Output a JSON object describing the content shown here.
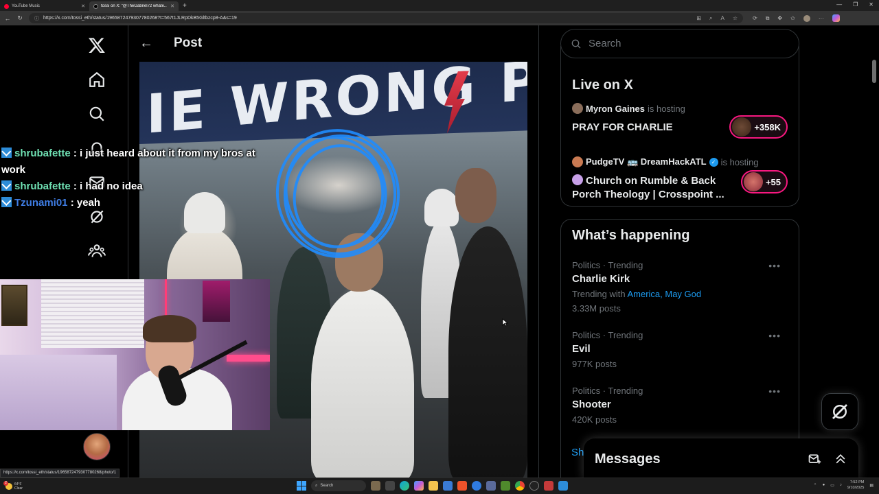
{
  "browser": {
    "tabs": [
      {
        "title": "YouTube Music",
        "active": false
      },
      {
        "title": "tossi on X: \"@TheGabriel72 whate...\"",
        "active": true
      }
    ],
    "url": "https://x.com/tossi_eth/status/1965872479307780268?t=567t1JLRpDkB5Gltbzcp8-A&s=19",
    "status_url": "https://x.com/tossi_eth/status/1965872479307780268/photo/1"
  },
  "post": {
    "title": "Post",
    "video_banner_text": "IE WRONG  P"
  },
  "chat": [
    {
      "user": "shrubafette",
      "text": " : i just heard about it from my bros at work",
      "color": "green"
    },
    {
      "user": "shrubafette",
      "text": " : i had no idea",
      "color": "green"
    },
    {
      "user": "Tzunami01",
      "text": " : yeah",
      "color": "blue"
    }
  ],
  "search": {
    "placeholder": "Search"
  },
  "live": {
    "title": "Live on X",
    "items": [
      {
        "host": "Myron Gaines",
        "hosting_label": "is hosting",
        "title": "PRAY FOR CHARLIE",
        "count": "+358K"
      },
      {
        "host": "PudgeTV 🚌 DreamHackATL",
        "hosting_label": "is hosting",
        "title": "Church on Rumble & Back Porch Theology | Crosspoint ...",
        "count": "+55"
      }
    ]
  },
  "happening": {
    "title": "What’s happening",
    "trends": [
      {
        "meta": "Politics · Trending",
        "name": "Charlie Kirk",
        "with_label": "Trending with",
        "with_links": "America, May God",
        "posts": "3.33M posts"
      },
      {
        "meta": "Politics · Trending",
        "name": "Evil",
        "posts": "977K posts"
      },
      {
        "meta": "Politics · Trending",
        "name": "Shooter",
        "posts": "420K posts"
      }
    ],
    "show_more": "Sh"
  },
  "messages": {
    "title": "Messages"
  },
  "taskbar": {
    "weather_temp": "64°F",
    "weather_cond": "Clear",
    "weather_badge": "2",
    "search_label": "Search",
    "time": "7:52 PM",
    "date": "9/10/2025"
  },
  "colors": {
    "accent": "#1d9bf0",
    "live_pink": "#f91880",
    "chat_green": "#6fe0b3",
    "chat_blue": "#3f7de4"
  }
}
